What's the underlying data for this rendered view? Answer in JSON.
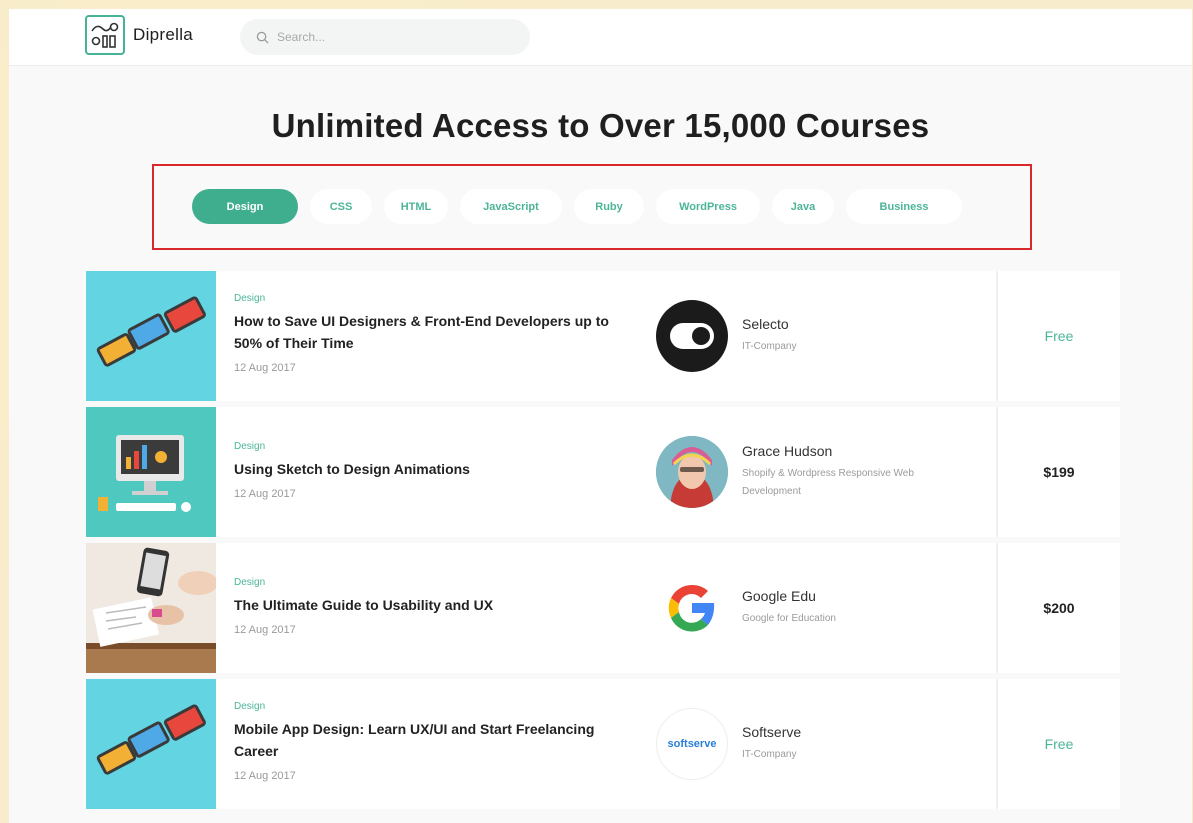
{
  "header": {
    "brand": "Diprella",
    "search_placeholder": "Search..."
  },
  "hero_title": "Unlimited Access to Over 15,000 Courses",
  "tabs": [
    {
      "label": "Design",
      "active": true
    },
    {
      "label": "CSS",
      "active": false
    },
    {
      "label": "HTML",
      "active": false
    },
    {
      "label": "JavaScript",
      "active": false
    },
    {
      "label": "Ruby",
      "active": false
    },
    {
      "label": "WordPress",
      "active": false
    },
    {
      "label": "Java",
      "active": false
    },
    {
      "label": "Business",
      "active": false
    }
  ],
  "courses": [
    {
      "category": "Design",
      "title": "How to Save UI Designers & Front-End Developers up to 50% of Their Time",
      "date": "12 Aug 2017",
      "author": "Selecto",
      "author_sub": "IT-Company",
      "price": "Free"
    },
    {
      "category": "Design",
      "title": "Using Sketch to Design Animations",
      "date": "12 Aug 2017",
      "author": "Grace Hudson",
      "author_sub": "Shopify & Wordpress Responsive Web Development",
      "price": "$199"
    },
    {
      "category": "Design",
      "title": "The Ultimate Guide to Usability and UX",
      "date": "12 Aug 2017",
      "author": "Google Edu",
      "author_sub": "Google for Education",
      "price": "$200"
    },
    {
      "category": "Design",
      "title": "Mobile App Design: Learn UX/UI and Start Freelancing Career",
      "date": "12 Aug 2017",
      "author": "Softserve",
      "author_sub": "IT-Company",
      "author_logo_text": "softserve",
      "price": "Free"
    }
  ],
  "colors": {
    "accent": "#3fae8f",
    "highlight_frame": "#d9282c"
  }
}
